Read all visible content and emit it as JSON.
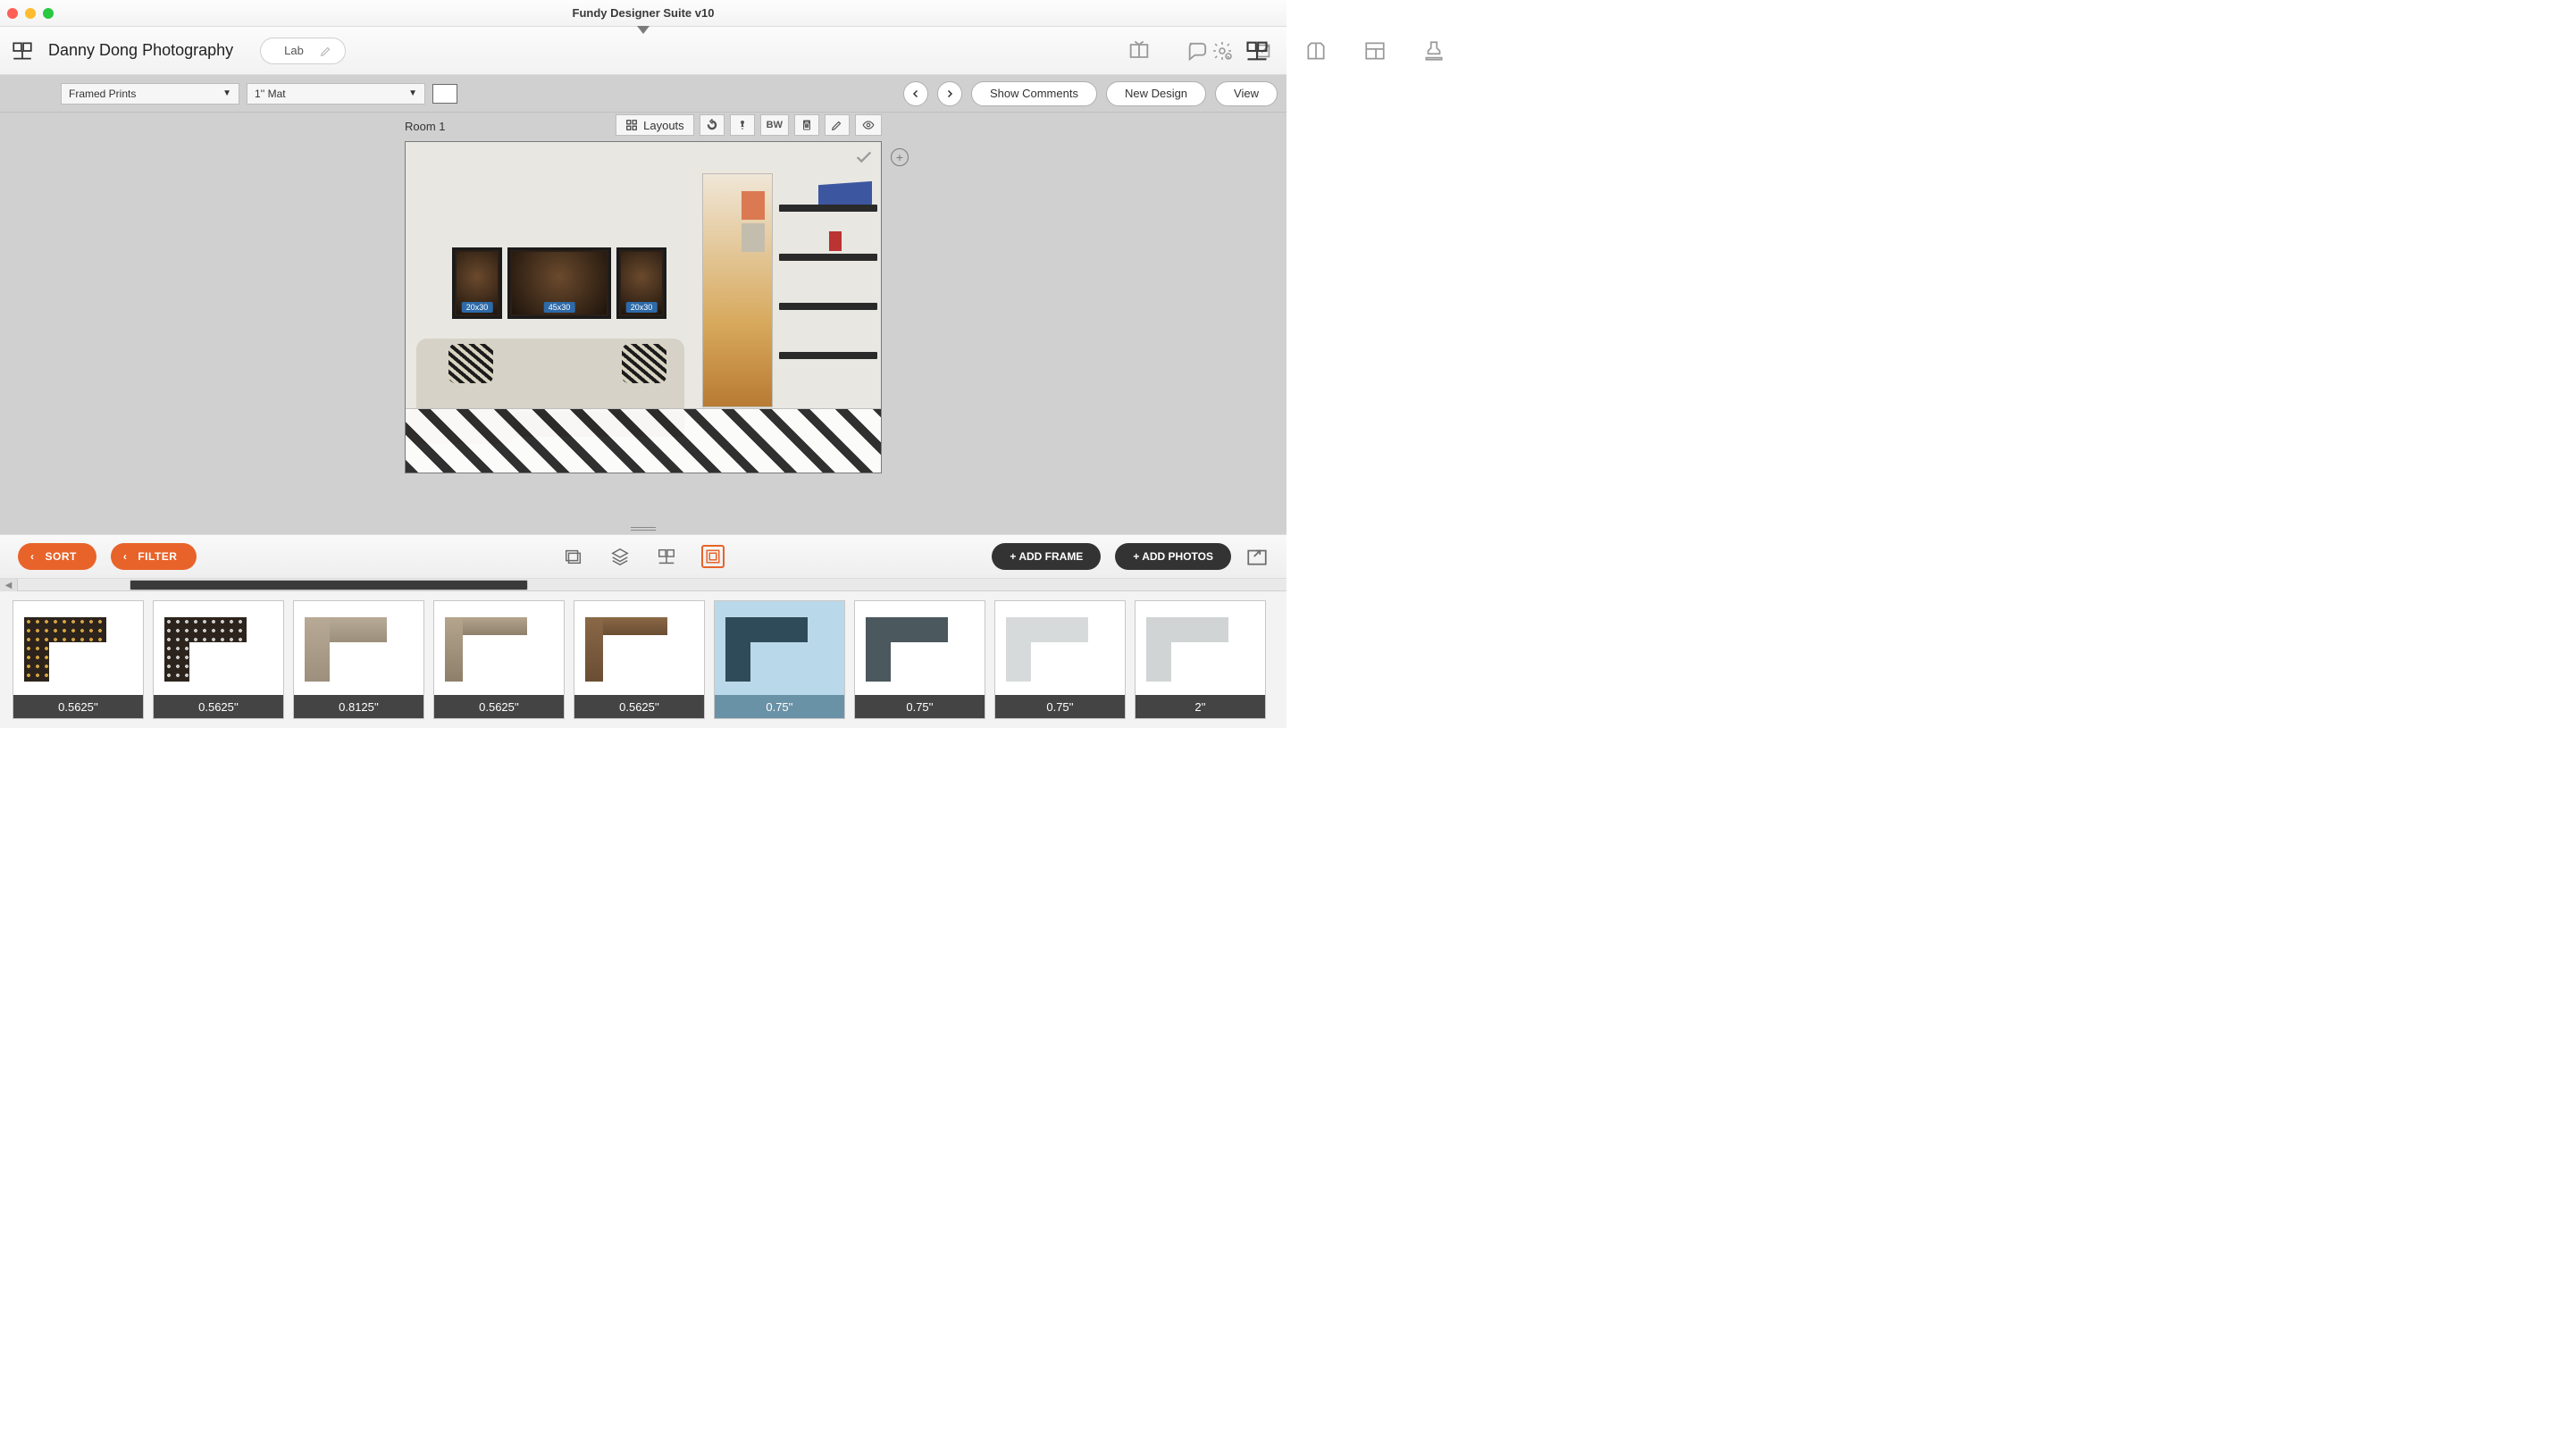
{
  "window": {
    "title": "Fundy Designer Suite v10"
  },
  "header": {
    "project_title": "Danny Dong Photography",
    "lab_label": "Lab"
  },
  "options": {
    "product_selected": "Framed Prints",
    "mat_selected": "1'' Mat"
  },
  "actions": {
    "show_comments": "Show Comments",
    "new_design": "New Design",
    "view": "View"
  },
  "canvas": {
    "room_label": "Room 1",
    "layouts_label": "Layouts",
    "bw_label": "BW",
    "frames": [
      {
        "size": "20x30",
        "orientation": "portrait"
      },
      {
        "size": "45x30",
        "orientation": "landscape"
      },
      {
        "size": "20x30",
        "orientation": "portrait"
      }
    ]
  },
  "bottom": {
    "sort": "SORT",
    "filter": "FILTER",
    "add_frame": "+ ADD FRAME",
    "add_photos": "+ ADD PHOTOS"
  },
  "thumbs": [
    {
      "label": "0.5625''",
      "style": "studded",
      "selected": false
    },
    {
      "label": "0.5625''",
      "style": "studded2",
      "selected": false
    },
    {
      "label": "0.8125''",
      "style": "taupe",
      "selected": false
    },
    {
      "label": "0.5625''",
      "style": "taupe-thin",
      "selected": false
    },
    {
      "label": "0.5625''",
      "style": "brown",
      "selected": false
    },
    {
      "label": "0.75''",
      "style": "slate",
      "selected": true
    },
    {
      "label": "0.75''",
      "style": "charcoal",
      "selected": false
    },
    {
      "label": "0.75''",
      "style": "ltgrey",
      "selected": false
    },
    {
      "label": "2''",
      "style": "ltgrey2",
      "selected": false
    }
  ]
}
